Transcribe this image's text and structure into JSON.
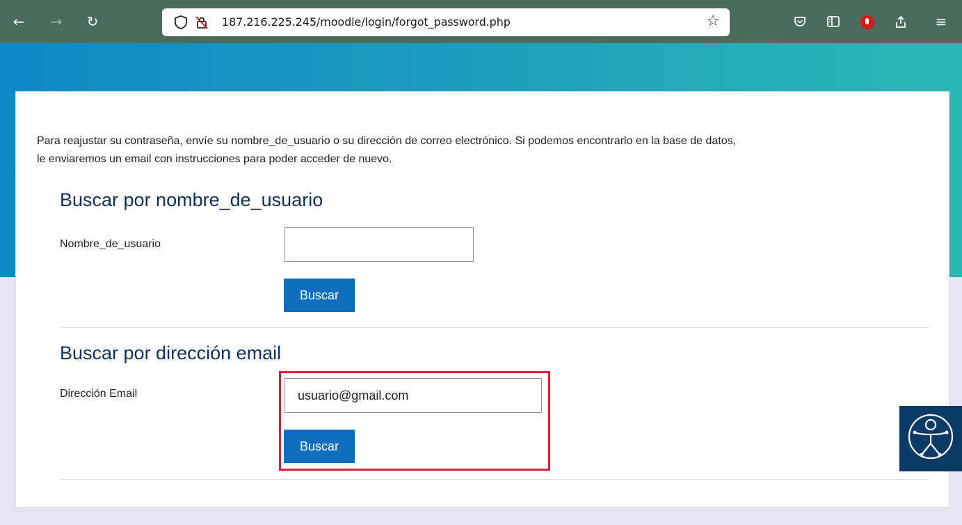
{
  "browser": {
    "url": "187.216.225.245/moodle/login/forgot_password.php",
    "icons": [
      "back-icon",
      "forward-icon",
      "reload-icon",
      "shield-icon",
      "insecure-lock-icon",
      "bookmark-star-icon",
      "pocket-icon",
      "reader-view-icon",
      "extension-icon",
      "share-icon",
      "menu-icon"
    ]
  },
  "page": {
    "intro_line1": "Para reajustar su contraseña, envíe su nombre_de_usuario o su dirección de correo electrónico. Si podemos encontrarlo en la base de datos,",
    "intro_line2": "le enviaremos un email con instrucciones para poder acceder de nuevo.",
    "username_section": {
      "title": "Buscar por nombre_de_usuario",
      "label": "Nombre_de_usuario",
      "value": "",
      "button": "Buscar"
    },
    "email_section": {
      "title": "Buscar por dirección email",
      "label": "Dirección Email",
      "value": "usuario@gmail.com",
      "button": "Buscar"
    }
  },
  "colors": {
    "toolbar": "#4b6b5c",
    "header_start": "#1187c6",
    "header_end": "#2bb8b4",
    "button": "#0f6cbf",
    "heading": "#0f2f57",
    "highlight": "#e0202b",
    "accessibility_widget": "#0b3a66"
  }
}
